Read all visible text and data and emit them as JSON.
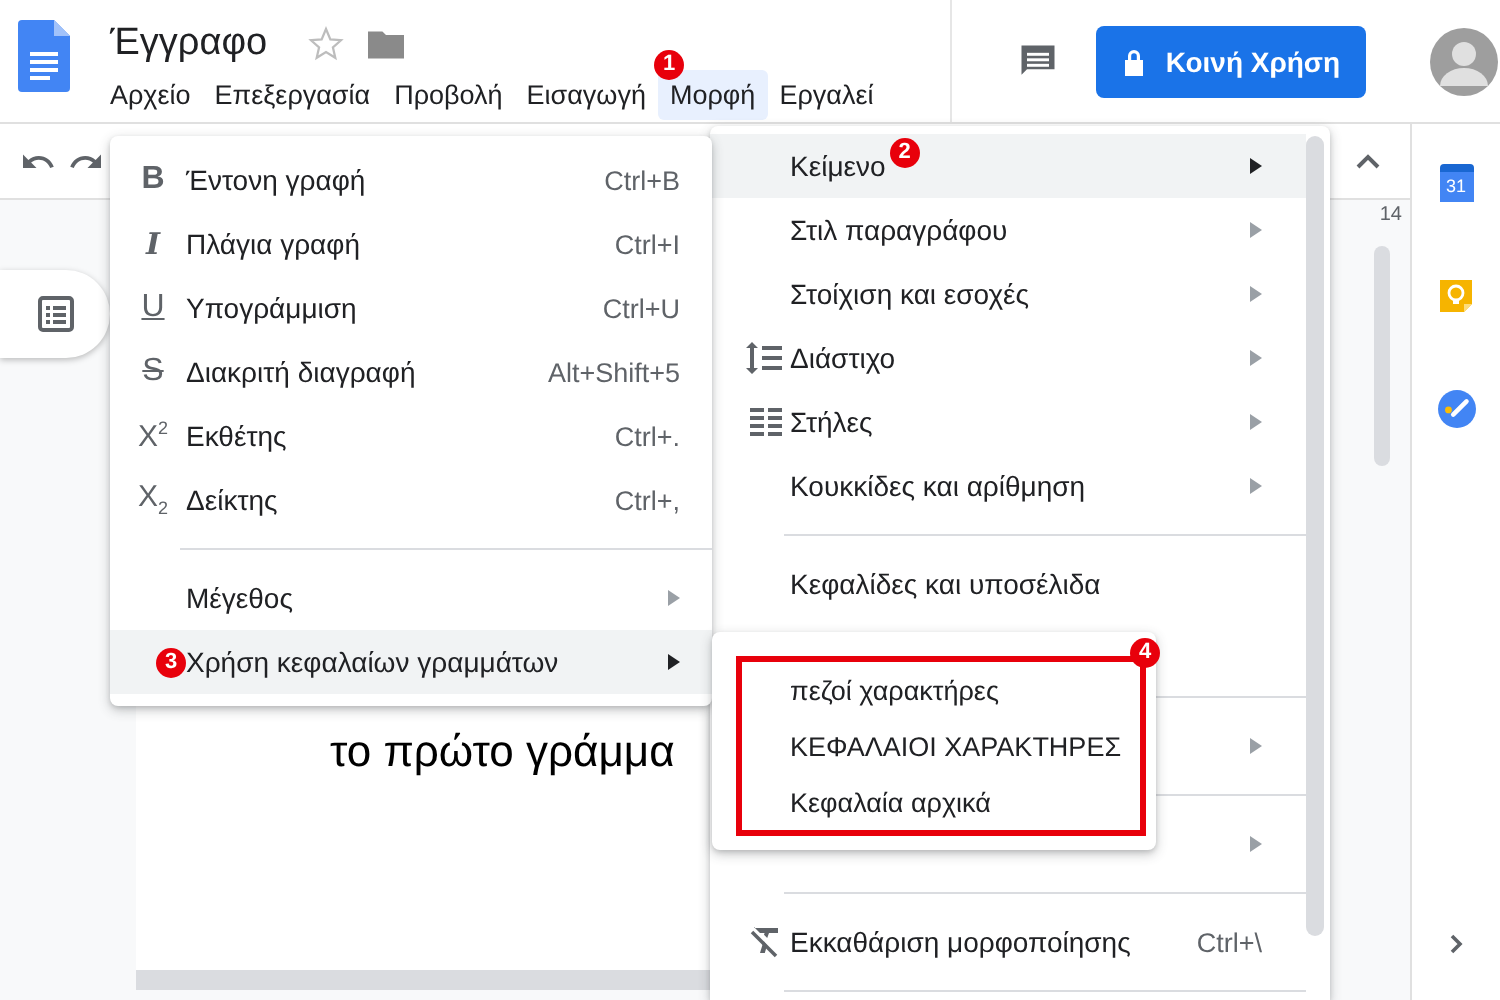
{
  "document": {
    "title": "Έγγραφο",
    "starred": false
  },
  "menubar": [
    {
      "label": "Αρχείο",
      "selected": false
    },
    {
      "label": "Επεξεργασία",
      "selected": false
    },
    {
      "label": "Προβολή",
      "selected": false
    },
    {
      "label": "Εισαγωγή",
      "selected": false
    },
    {
      "label": "Μορφή",
      "selected": true,
      "badge": "1"
    },
    {
      "label": "Εργαλεί",
      "selected": false
    }
  ],
  "share_button": {
    "label": "Κοινή Χρήση"
  },
  "side_panel": {
    "calendar_day": "31"
  },
  "ruler": {
    "mark": "14"
  },
  "page": {
    "text": "το πρώτο γράμμα"
  },
  "format_menu": {
    "items": [
      {
        "kind": "submenu",
        "label": "Κείμενο",
        "selected": true,
        "badge": "2"
      },
      {
        "kind": "submenu",
        "label": "Στιλ παραγράφου",
        "selected": false
      },
      {
        "kind": "submenu",
        "label": "Στοίχιση και εσοχές",
        "selected": false
      },
      {
        "kind": "submenu",
        "label": "Διάστιχο",
        "selected": false
      },
      {
        "kind": "submenu",
        "label": "Στήλες",
        "selected": false
      },
      {
        "kind": "submenu",
        "label": "Κουκκίδες και αρίθμηση",
        "selected": false
      },
      {
        "kind": "divider"
      },
      {
        "kind": "item",
        "label": "Κεφαλίδες και υποσέλιδα",
        "selected": false
      },
      {
        "kind": "covered"
      },
      {
        "kind": "divider"
      },
      {
        "kind": "covered_submenu"
      },
      {
        "kind": "divider"
      },
      {
        "kind": "covered_submenu"
      },
      {
        "kind": "divider"
      },
      {
        "kind": "item",
        "label": "Εκκαθάριση μορφοποίησης",
        "shortcut": "Ctrl+\\",
        "selected": false
      },
      {
        "kind": "divider"
      }
    ]
  },
  "text_menu": {
    "items": [
      {
        "kind": "item",
        "glyph": "B",
        "label": "Έντονη γραφή",
        "shortcut": "Ctrl+B",
        "selected": false
      },
      {
        "kind": "item",
        "glyph": "I",
        "label": "Πλάγια γραφή",
        "shortcut": "Ctrl+I",
        "selected": false
      },
      {
        "kind": "item",
        "glyph": "U",
        "label": "Υπογράμμιση",
        "shortcut": "Ctrl+U",
        "selected": false
      },
      {
        "kind": "item",
        "glyph": "S",
        "label": "Διακριτή διαγραφή",
        "shortcut": "Alt+Shift+5",
        "selected": false
      },
      {
        "kind": "item",
        "glyph": "X$^{2}$",
        "label": "Εκθέτης",
        "shortcut": "Ctrl+.",
        "selected": false
      },
      {
        "kind": "item",
        "glyph": "X$_{2}$",
        "label": "Δείκτης",
        "shortcut": "Ctrl+,",
        "selected": false
      },
      {
        "kind": "divider"
      },
      {
        "kind": "submenu",
        "label": "Μέγεθος",
        "selected": false
      },
      {
        "kind": "submenu",
        "label": "Χρήση κεφαλαίων γραμμάτων",
        "selected": true,
        "badge": "3"
      }
    ]
  },
  "case_menu": {
    "outlined": true,
    "badge": "4",
    "items": [
      {
        "label": "πεζοί χαρακτήρες"
      },
      {
        "label": "ΚΕΦΑΛΑΙΟΙ ΧΑΡΑΚΤΗΡΕΣ"
      },
      {
        "label": "Κεφαλαία αρχικά"
      }
    ]
  }
}
